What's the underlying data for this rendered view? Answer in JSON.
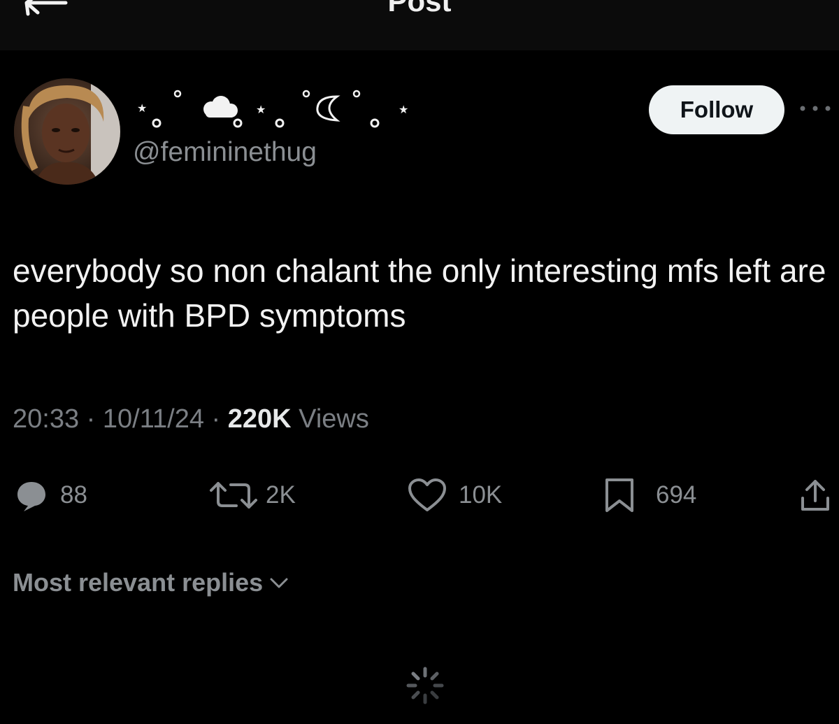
{
  "header": {
    "title": "Post",
    "back_icon": "arrow-left-icon"
  },
  "author": {
    "display_name_icons": [
      "star-icon",
      "circle-icon",
      "cloud-icon",
      "circle-icon",
      "star-icon",
      "circle-icon",
      "crescent-moon-icon",
      "circle-icon",
      "star-icon"
    ],
    "handle": "@femininethug",
    "follow_label": "Follow"
  },
  "post": {
    "text": "everybody so non chalant the only interesting mfs left are people with BPD symptoms",
    "time": "20:33",
    "date": "10/11/24",
    "separator": "·",
    "views_count": "220K",
    "views_label": "Views"
  },
  "actions": {
    "replies": "88",
    "reposts": "2K",
    "likes": "10K",
    "bookmarks": "694"
  },
  "replies": {
    "sort_label": "Most relevant replies"
  },
  "colors": {
    "background": "#000000",
    "text_primary": "#f2f2f2",
    "text_secondary": "#8b8f93",
    "follow_button_bg": "#eff3f4"
  }
}
